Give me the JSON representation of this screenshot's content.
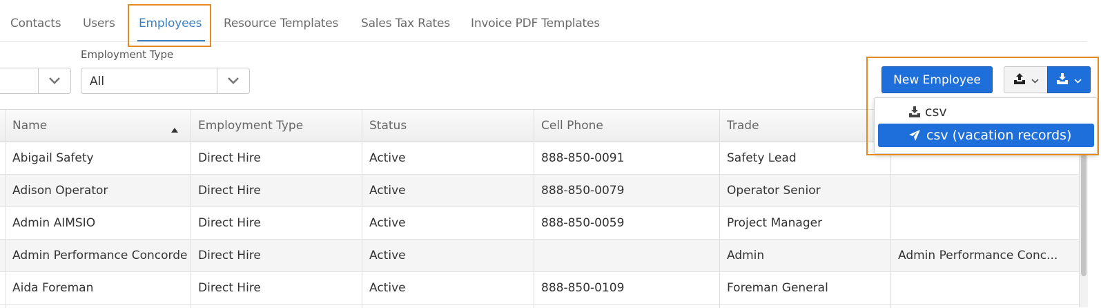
{
  "tabs": [
    {
      "label": "Contacts"
    },
    {
      "label": "Users"
    },
    {
      "label": "Employees",
      "active": true
    },
    {
      "label": "Resource Templates"
    },
    {
      "label": "Sales Tax Rates"
    },
    {
      "label": "Invoice PDF Templates"
    }
  ],
  "filters": {
    "first_select_value": "",
    "employment_type_label": "Employment Type",
    "employment_type_value": "All"
  },
  "toolbar": {
    "new_employee_label": "New Employee",
    "upload_icon": "upload-icon",
    "download_icon": "download-icon"
  },
  "export_menu": {
    "items": [
      {
        "label": "csv",
        "icon": "download-icon"
      },
      {
        "label": "csv (vacation records)",
        "icon": "plane-icon",
        "selected": true
      }
    ]
  },
  "grid": {
    "columns": [
      "Name",
      "Employment Type",
      "Status",
      "Cell Phone",
      "Trade",
      ""
    ],
    "sort_column": "Name",
    "sort_direction": "ascending",
    "rows": [
      [
        "Abigail Safety",
        "Direct Hire",
        "Active",
        "888-850-0091",
        "Safety Lead",
        ""
      ],
      [
        "Adison Operator",
        "Direct Hire",
        "Active",
        "888-850-0079",
        "Operator Senior",
        ""
      ],
      [
        "Admin AIMSIO",
        "Direct Hire",
        "Active",
        "888-850-0059",
        "Project Manager",
        ""
      ],
      [
        "Admin Performance Concorde",
        "Direct Hire",
        "Active",
        "",
        "Admin",
        "Admin Performance Conc..."
      ],
      [
        "Aida Foreman",
        "Direct Hire",
        "Active",
        "888-850-0109",
        "Foreman General",
        ""
      ]
    ]
  },
  "colors": {
    "accent": "#1e6fd9",
    "active_tab": "#3a82c4",
    "highlight_box": "#e58a1f"
  }
}
